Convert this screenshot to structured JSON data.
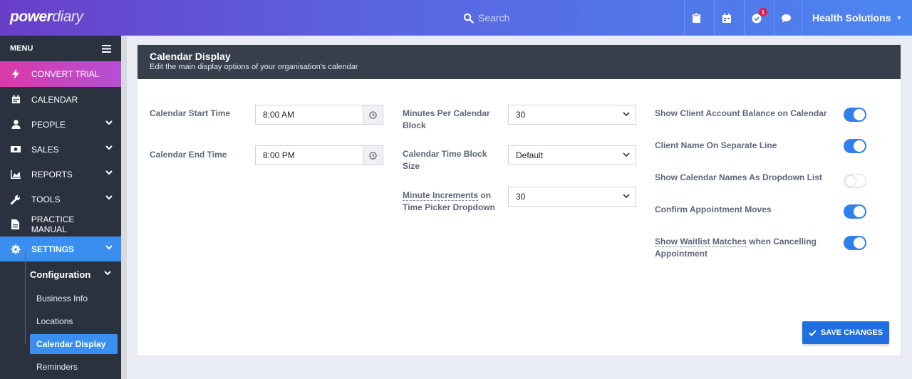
{
  "topbar": {
    "logo_bold": "power",
    "logo_light": "diary",
    "search_placeholder": "Search",
    "notification_count": "1",
    "account_name": "Health Solutions"
  },
  "sidebar": {
    "menu_label": "MENU",
    "items": [
      {
        "label": "CONVERT TRIAL",
        "icon": "bolt-icon"
      },
      {
        "label": "CALENDAR",
        "icon": "calendar-icon"
      },
      {
        "label": "PEOPLE",
        "icon": "person-icon"
      },
      {
        "label": "SALES",
        "icon": "money-icon"
      },
      {
        "label": "REPORTS",
        "icon": "chart-icon"
      },
      {
        "label": "TOOLS",
        "icon": "wrench-icon"
      },
      {
        "label": "PRACTICE MANUAL",
        "icon": "document-icon"
      },
      {
        "label": "SETTINGS",
        "icon": "gear-icon"
      }
    ],
    "submenu_head": "Configuration",
    "subitems": [
      "Business Info",
      "Locations",
      "Calendar Display",
      "Reminders"
    ]
  },
  "panel": {
    "title": "Calendar Display",
    "subtitle": "Edit the main display options of your organisation's calendar"
  },
  "form": {
    "start_time_label": "Calendar Start Time",
    "start_time_value": "8:00 AM",
    "end_time_label": "Calendar End Time",
    "end_time_value": "8:00 PM",
    "minutes_per_block_label_1": "Minutes Per Calendar",
    "minutes_per_block_label_2": "Block",
    "minutes_per_block_value": "30",
    "time_block_size_label_1": "Calendar Time Block",
    "time_block_size_label_2": "Size",
    "time_block_size_value": "Default",
    "minute_increments_label_1": "Minute Increments",
    "minute_increments_label_1b": " on",
    "minute_increments_label_2": "Time Picker Dropdown",
    "minute_increments_value": "30",
    "toggles": [
      {
        "label": "Show Client Account Balance on Calendar",
        "on": true
      },
      {
        "label": "Client Name On Separate Line",
        "on": true
      },
      {
        "label": "Show Calendar Names As Dropdown List",
        "on": false
      },
      {
        "label": "Confirm Appointment Moves",
        "on": true
      }
    ],
    "waitlist_label_a": "Show Waitlist Matches",
    "waitlist_label_b": " when Cancelling",
    "waitlist_label_c": "Appointment",
    "waitlist_on": true,
    "save_label": "SAVE CHANGES"
  },
  "colors": {
    "accent": "#2f80ed",
    "sidebar_bg": "#2a3240",
    "panel_header": "#373f4d"
  }
}
